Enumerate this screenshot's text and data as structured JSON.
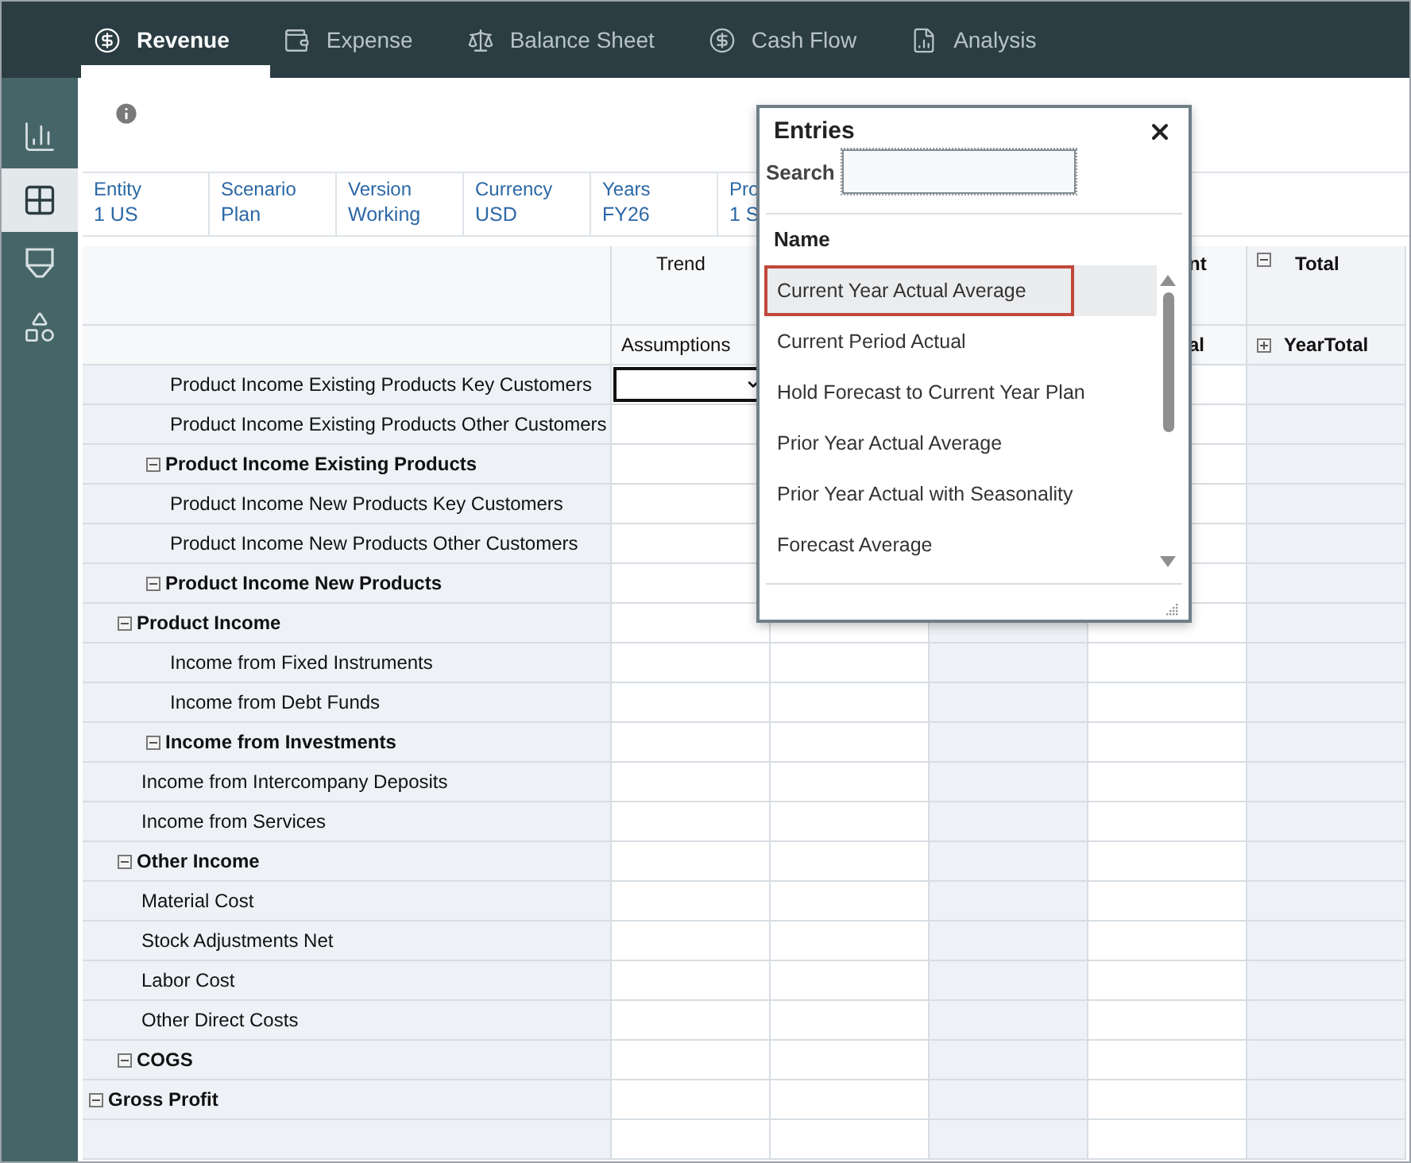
{
  "tabs": [
    {
      "label": "Revenue",
      "selected": true
    },
    {
      "label": "Expense",
      "selected": false
    },
    {
      "label": "Balance Sheet",
      "selected": false
    },
    {
      "label": "Cash Flow",
      "selected": false
    },
    {
      "label": "Analysis",
      "selected": false
    }
  ],
  "sidebar": {
    "items": [
      {
        "selected": false
      },
      {
        "selected": true
      },
      {
        "selected": false
      },
      {
        "selected": false
      }
    ]
  },
  "pov": [
    {
      "label": "Entity",
      "value": "1 US"
    },
    {
      "label": "Scenario",
      "value": "Plan"
    },
    {
      "label": "Version",
      "value": "Working"
    },
    {
      "label": "Currency",
      "value": "USD"
    },
    {
      "label": "Years",
      "value": "FY26"
    },
    {
      "label": "Pro",
      "value": "1 S"
    }
  ],
  "grid": {
    "columns": [
      {
        "header": "Trend",
        "subheader": "Assumptions",
        "kind": "input"
      },
      {
        "kind": "input"
      },
      {
        "kind": "readonly"
      },
      {
        "header": "nt",
        "subheader": "al",
        "kind": "input"
      },
      {
        "header": "Total",
        "subheader": "YearTotal",
        "kind": "readonly",
        "expanded": true,
        "sub_expanded": false
      }
    ],
    "rows": [
      {
        "label": "Gross Profit",
        "expanded": true,
        "selected": false,
        "children": [
          {
            "label": "Product Income",
            "expanded": true,
            "selected": false,
            "children": [
              {
                "label": "Product Income Existing Products",
                "expanded": true,
                "selected": false,
                "children": [
                  {
                    "label": "Product Income Existing Products Key Customers",
                    "selected": true
                  },
                  {
                    "label": "Product Income Existing Products Other Customers",
                    "selected": false
                  }
                ]
              },
              {
                "label": "Product Income New Products",
                "expanded": true,
                "selected": false,
                "children": [
                  {
                    "label": "Product Income New Products Key Customers",
                    "selected": false
                  },
                  {
                    "label": "Product Income New Products Other Customers",
                    "selected": false
                  }
                ]
              }
            ]
          },
          {
            "label": "Other Income",
            "expanded": true,
            "selected": false,
            "children": [
              {
                "label": "Income from Investments",
                "expanded": true,
                "selected": false,
                "children": [
                  {
                    "label": "Income from Fixed Instruments",
                    "selected": false
                  },
                  {
                    "label": "Income from Debt Funds",
                    "selected": false
                  }
                ]
              },
              {
                "label": "Income from Intercompany Deposits",
                "selected": false
              },
              {
                "label": "Income from Services",
                "selected": false
              }
            ]
          },
          {
            "label": "COGS",
            "expanded": true,
            "selected": false,
            "children": [
              {
                "label": "Material Cost",
                "selected": false
              },
              {
                "label": "Stock Adjustments Net",
                "selected": false
              },
              {
                "label": "Labor Cost",
                "selected": false
              },
              {
                "label": "Other Direct Costs",
                "selected": false
              }
            ]
          }
        ]
      }
    ]
  },
  "dialog": {
    "title": "Entries",
    "search_label": "Search",
    "list_header": "Name",
    "items": [
      {
        "label": "Current Year Actual Average",
        "selected": true
      },
      {
        "label": "Current Period Actual",
        "selected": false
      },
      {
        "label": "Hold Forecast to Current Year Plan",
        "selected": false
      },
      {
        "label": "Prior Year Actual Average",
        "selected": false
      },
      {
        "label": "Prior Year Actual with Seasonality",
        "selected": false
      },
      {
        "label": "Forecast Average",
        "selected": false
      }
    ]
  }
}
